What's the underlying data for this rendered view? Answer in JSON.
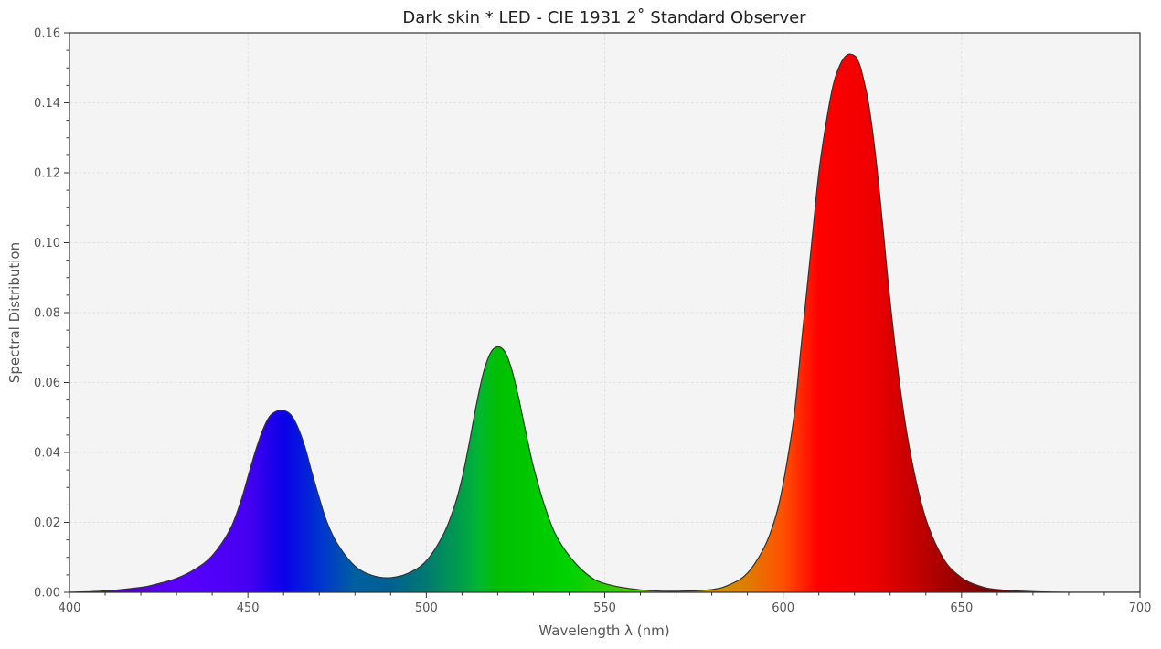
{
  "chart_data": {
    "type": "area",
    "title": "Dark skin * LED - CIE 1931 2$^\\circ$ Standard Observer",
    "title_display": "Dark skin * LED - CIE 1931 2˚ Standard Observer",
    "xlabel": "Wavelength λ (nm)",
    "ylabel": "Spectral Distribution",
    "xlim": [
      400,
      700
    ],
    "ylim": [
      0,
      0.16
    ],
    "x_ticks": [
      "400",
      "450",
      "500",
      "550",
      "600",
      "650",
      "700"
    ],
    "y_ticks": [
      "0.00",
      "0.02",
      "0.04",
      "0.06",
      "0.08",
      "0.10",
      "0.12",
      "0.14",
      "0.16"
    ],
    "x_tick_values": [
      400,
      450,
      500,
      550,
      600,
      650,
      700
    ],
    "y_tick_values": [
      0,
      0.02,
      0.04,
      0.06,
      0.08,
      0.1,
      0.12,
      0.14,
      0.16
    ],
    "grid": true,
    "fill": "spectral-colors",
    "series": [
      {
        "x": [
          400,
          410,
          420,
          425,
          430,
          435,
          440,
          445,
          448,
          450,
          452,
          454,
          456,
          458,
          460,
          462,
          464,
          466,
          468,
          470,
          472,
          475,
          480,
          485,
          490,
          495,
          500,
          505,
          508,
          510,
          512,
          514,
          516,
          518,
          520,
          522,
          524,
          526,
          528,
          530,
          533,
          536,
          540,
          545,
          550,
          560,
          570,
          580,
          585,
          590,
          595,
          598,
          600,
          603,
          605,
          608,
          610,
          612,
          614,
          616,
          618,
          620,
          621,
          622,
          624,
          626,
          628,
          630,
          633,
          636,
          640,
          645,
          650,
          655,
          660,
          670,
          680,
          700
        ],
        "y": [
          0.0,
          0.0004,
          0.0014,
          0.0025,
          0.004,
          0.0065,
          0.0105,
          0.018,
          0.026,
          0.033,
          0.04,
          0.046,
          0.0502,
          0.0518,
          0.052,
          0.0508,
          0.0472,
          0.0415,
          0.034,
          0.027,
          0.0205,
          0.014,
          0.0075,
          0.0048,
          0.0042,
          0.0055,
          0.009,
          0.017,
          0.025,
          0.0325,
          0.0425,
          0.0535,
          0.0628,
          0.0685,
          0.0702,
          0.0688,
          0.0635,
          0.055,
          0.0452,
          0.036,
          0.0252,
          0.017,
          0.0105,
          0.0052,
          0.0025,
          0.0007,
          0.0003,
          0.0008,
          0.0022,
          0.0055,
          0.0135,
          0.022,
          0.031,
          0.05,
          0.07,
          0.1,
          0.12,
          0.134,
          0.145,
          0.151,
          0.1538,
          0.1535,
          0.152,
          0.149,
          0.1395,
          0.124,
          0.104,
          0.083,
          0.057,
          0.038,
          0.021,
          0.0095,
          0.0042,
          0.0018,
          0.0008,
          0.0002,
          0.0,
          0.0
        ]
      }
    ]
  }
}
